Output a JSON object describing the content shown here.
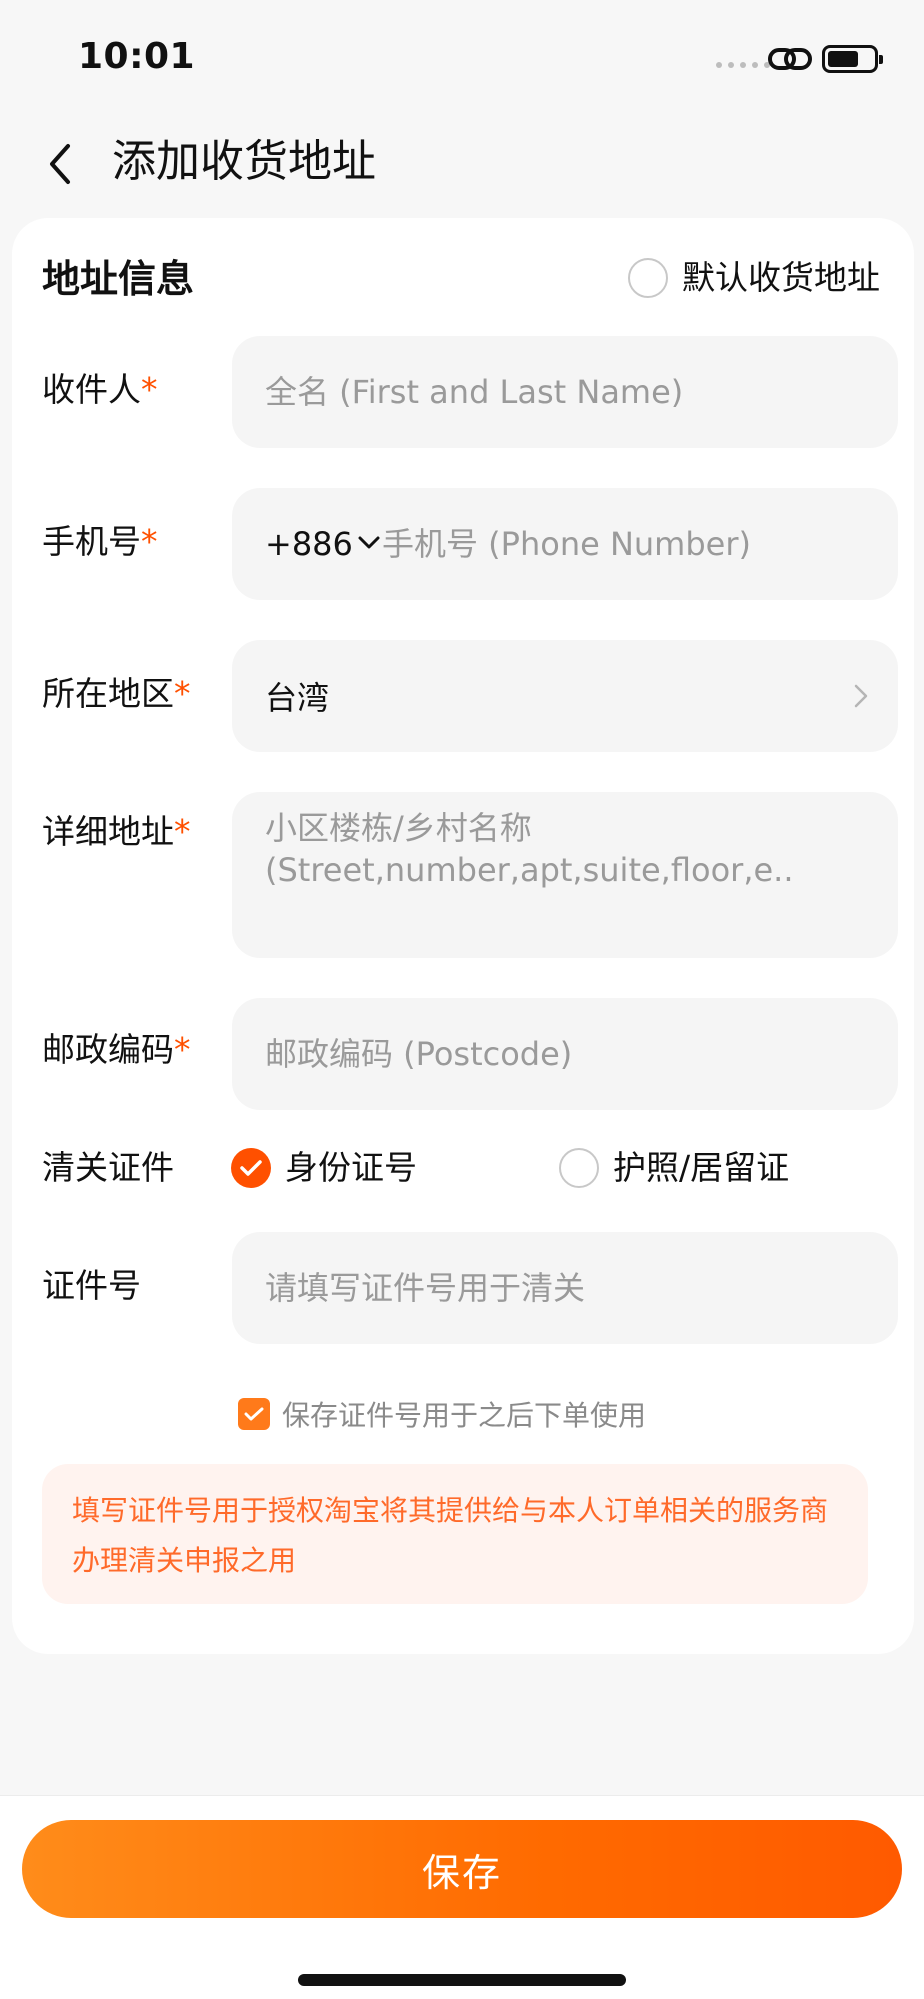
{
  "status": {
    "time": "10:01"
  },
  "nav": {
    "title": "添加收货地址"
  },
  "section": {
    "title": "地址信息",
    "default_label": "默认收货地址"
  },
  "required_mark": "*",
  "fields": {
    "recipient": {
      "label": "收件人",
      "placeholder": "全名 (First and Last Name)"
    },
    "phone": {
      "label": "手机号",
      "country_code": "+886",
      "placeholder": "手机号 (Phone Number)"
    },
    "region": {
      "label": "所在地区",
      "value": "台湾"
    },
    "address": {
      "label": "详细地址",
      "placeholder_line1": "小区楼栋/乡村名称",
      "placeholder_line2": "(Street,number,apt,suite,floor,e.."
    },
    "postcode": {
      "label": "邮政编码",
      "placeholder": "邮政编码 (Postcode)"
    },
    "customs": {
      "label": "清关证件",
      "option1": "身份证号",
      "option2": "护照/居留证",
      "selected": "身份证号"
    },
    "id_number": {
      "label": "证件号",
      "placeholder": "请填写证件号用于清关"
    }
  },
  "save_id": {
    "label": "保存证件号用于之后下单使用",
    "checked": true
  },
  "notice": {
    "text": "填写证件号用于授权淘宝将其提供给与本人订单相关的服务商办理清关申报之用"
  },
  "actions": {
    "save_label": "保存"
  },
  "colors": {
    "accent": "#ff5000",
    "button_start": "#ff8c1a",
    "button_end": "#ff5a00",
    "notice_bg": "#fff3ef"
  }
}
